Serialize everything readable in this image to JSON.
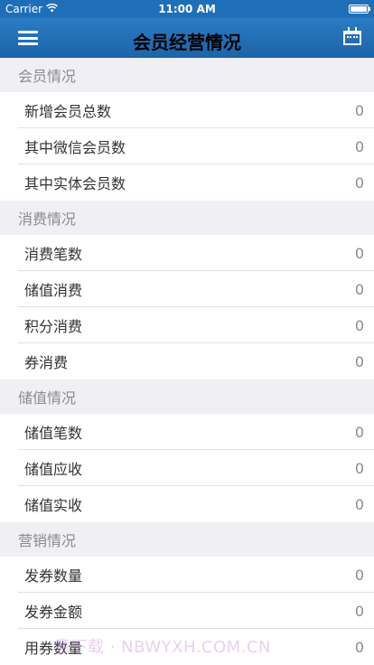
{
  "status_bar": {
    "carrier": "Carrier",
    "time": "11:00 AM"
  },
  "nav": {
    "title": "会员经营情况"
  },
  "sections": [
    {
      "title": "会员情况",
      "rows": [
        {
          "label": "新增会员总数",
          "value": "0"
        },
        {
          "label": "其中微信会员数",
          "value": "0"
        },
        {
          "label": "其中实体会员数",
          "value": "0"
        }
      ]
    },
    {
      "title": "消费情况",
      "rows": [
        {
          "label": "消费笔数",
          "value": "0"
        },
        {
          "label": "储值消费",
          "value": "0"
        },
        {
          "label": "积分消费",
          "value": "0"
        },
        {
          "label": "券消费",
          "value": "0"
        }
      ]
    },
    {
      "title": "储值情况",
      "rows": [
        {
          "label": "储值笔数",
          "value": "0"
        },
        {
          "label": "储值应收",
          "value": "0"
        },
        {
          "label": "储值实收",
          "value": "0"
        }
      ]
    },
    {
      "title": "营销情况",
      "rows": [
        {
          "label": "发券数量",
          "value": "0"
        },
        {
          "label": "发券金额",
          "value": "0"
        },
        {
          "label": "用券数量",
          "value": "0"
        }
      ]
    }
  ],
  "watermark": "意下载 · NBWYXH.COM.CN",
  "colors": {
    "nav_bar": "#1f6fb8",
    "background": "#efeff4"
  }
}
